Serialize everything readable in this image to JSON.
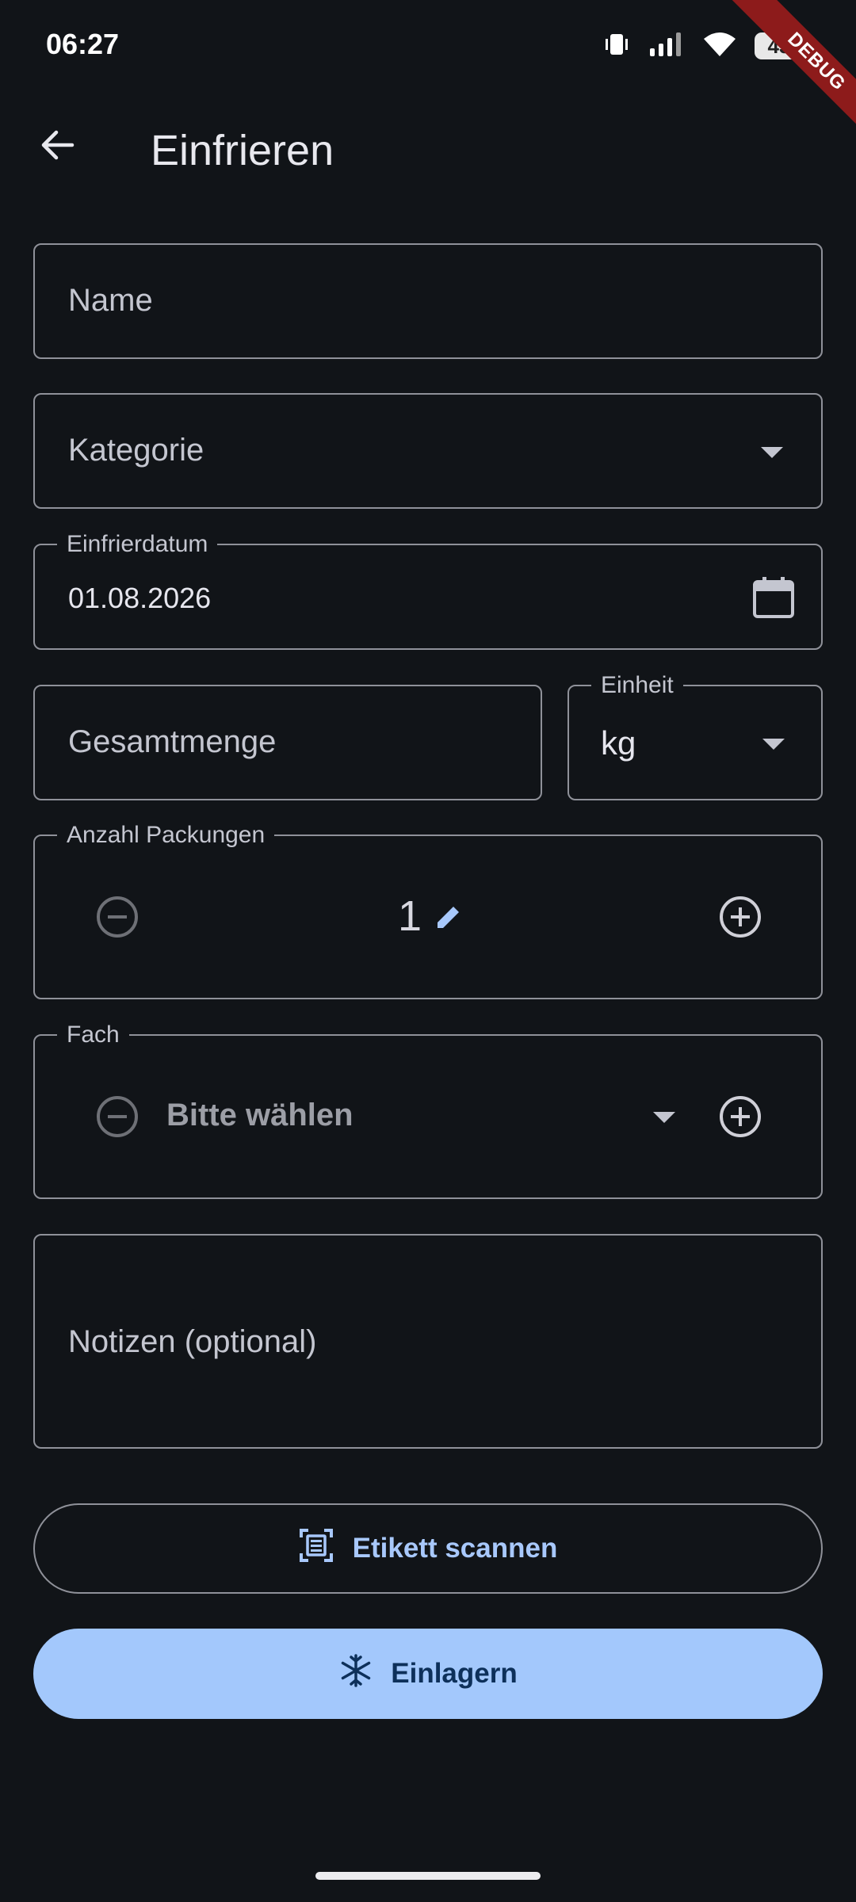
{
  "status_bar": {
    "time": "06:27",
    "battery": "43",
    "debug_label": "DEBUG"
  },
  "app_bar": {
    "title": "Einfrieren",
    "back_icon": "arrow-left-icon"
  },
  "form": {
    "name": {
      "placeholder": "Name"
    },
    "category": {
      "placeholder": "Kategorie"
    },
    "freeze_date": {
      "label": "Einfrierdatum",
      "value": "01.08.2026",
      "icon": "calendar-icon"
    },
    "total_amount": {
      "placeholder": "Gesamtmenge"
    },
    "unit": {
      "label": "Einheit",
      "value": "kg"
    },
    "packages": {
      "label": "Anzahl Packungen",
      "value": "1"
    },
    "compartment": {
      "label": "Fach",
      "placeholder": "Bitte wählen"
    },
    "notes": {
      "placeholder": "Notizen (optional)"
    }
  },
  "actions": {
    "scan_label": "Etikett scannen",
    "store_label": "Einlagern"
  },
  "colors": {
    "background": "#111418",
    "accent": "#a3c8fc",
    "accent_text": "#0d305a",
    "outline": "#8f9199",
    "debug_banner": "#8d1b1b"
  }
}
